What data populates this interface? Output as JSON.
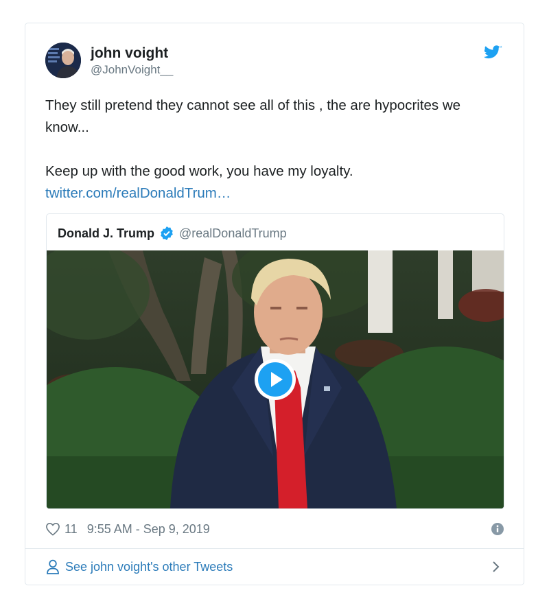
{
  "author": {
    "name": "john voight",
    "handle": "@JohnVoight__",
    "avatar_icon": "profile-photo"
  },
  "tweet": {
    "text_line1": "They still pretend they cannot see all of this , the are hypocrites we know...",
    "text_line2": "Keep up with the good work, you have my loyalty.",
    "link": "twitter.com/realDonaldTrum…"
  },
  "quoted_tweet": {
    "name": "Donald J. Trump",
    "handle": "@realDonaldTrump",
    "verified": true,
    "media": "video-thumbnail"
  },
  "meta": {
    "likes": "11",
    "timestamp": "9:55 AM - Sep 9, 2019"
  },
  "footer": {
    "label": "See john voight's other Tweets"
  },
  "colors": {
    "accent": "#1da1f2",
    "link": "#2b7bb9",
    "muted": "#697882",
    "border": "#e1e8ed",
    "tie": "#d41f2a"
  },
  "icons": [
    "twitter-bird-icon",
    "verified-badge-icon",
    "play-icon",
    "heart-icon",
    "info-icon",
    "person-icon",
    "chevron-right-icon"
  ]
}
